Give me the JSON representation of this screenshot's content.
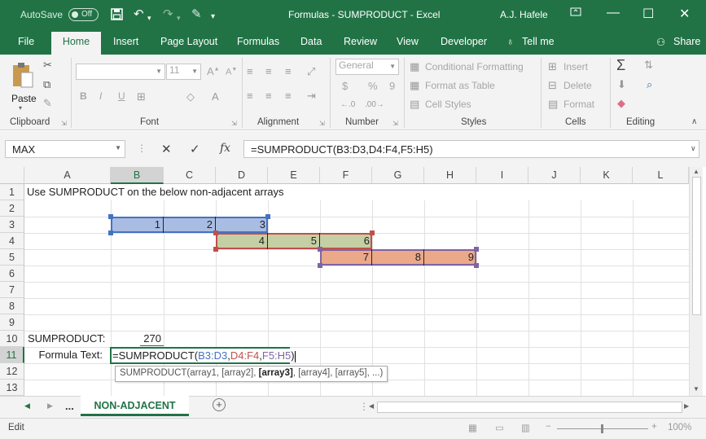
{
  "titlebar": {
    "autosave_label": "AutoSave",
    "autosave_state": "Off",
    "title": "Formulas - SUMPRODUCT  -  Excel",
    "user": "A.J. Hafele"
  },
  "tabs": [
    "File",
    "Home",
    "Insert",
    "Page Layout",
    "Formulas",
    "Data",
    "Review",
    "View",
    "Developer",
    "Tell me",
    "Share"
  ],
  "ribbon": {
    "clipboard": {
      "label": "Clipboard",
      "paste": "Paste"
    },
    "font": {
      "label": "Font",
      "font_name": "",
      "font_size": "11",
      "bold": "B",
      "italic": "I",
      "underline": "U"
    },
    "alignment": {
      "label": "Alignment"
    },
    "number": {
      "label": "Number",
      "format": "General",
      "currency": "$",
      "percent": "%",
      "comma": "9"
    },
    "styles": {
      "label": "Styles",
      "conditional": "Conditional Formatting",
      "table": "Format as Table",
      "cell_styles": "Cell Styles"
    },
    "cells": {
      "label": "Cells",
      "insert": "Insert",
      "delete": "Delete",
      "format": "Format"
    },
    "editing": {
      "label": "Editing"
    }
  },
  "formula_bar": {
    "name_box": "MAX",
    "formula": "=SUMPRODUCT(B3:D3,D4:F4,F5:H5)"
  },
  "grid": {
    "columns": [
      "A",
      "B",
      "C",
      "D",
      "E",
      "F",
      "G",
      "H",
      "I",
      "J",
      "K",
      "L"
    ],
    "rows": [
      "1",
      "2",
      "3",
      "4",
      "5",
      "6",
      "7",
      "8",
      "9",
      "10",
      "11",
      "12",
      "13"
    ],
    "a1": "Use SUMPRODUCT on the below non-adjacent arrays",
    "array1": [
      "1",
      "2",
      "3"
    ],
    "array2": [
      "4",
      "5",
      "6"
    ],
    "array3": [
      "7",
      "8",
      "9"
    ],
    "a10": "SUMPRODUCT:",
    "b10": "270",
    "a11": "Formula Text:",
    "edit": {
      "prefix": "=SUMPRODUCT(",
      "ref1": "B3:D3",
      "sep1": ",",
      "ref2": "D4:F4",
      "sep2": ",",
      "ref3": "F5:H5",
      "suffix": ")"
    },
    "tooltip": {
      "pre": "SUMPRODUCT(array1, [array2], ",
      "bold": "[array3]",
      "post": ", [array4], [array5], ...)"
    },
    "colors": {
      "ref1": "#4472c4",
      "ref2": "#c0504d",
      "ref3": "#8064a2",
      "fill1": "#a9bde3",
      "fill2": "#c5cfa4",
      "fill3": "#eba98a"
    }
  },
  "sheets": {
    "nav_more": "...",
    "active": "NON-ADJACENT"
  },
  "status": {
    "mode": "Edit",
    "zoom": "100%"
  }
}
